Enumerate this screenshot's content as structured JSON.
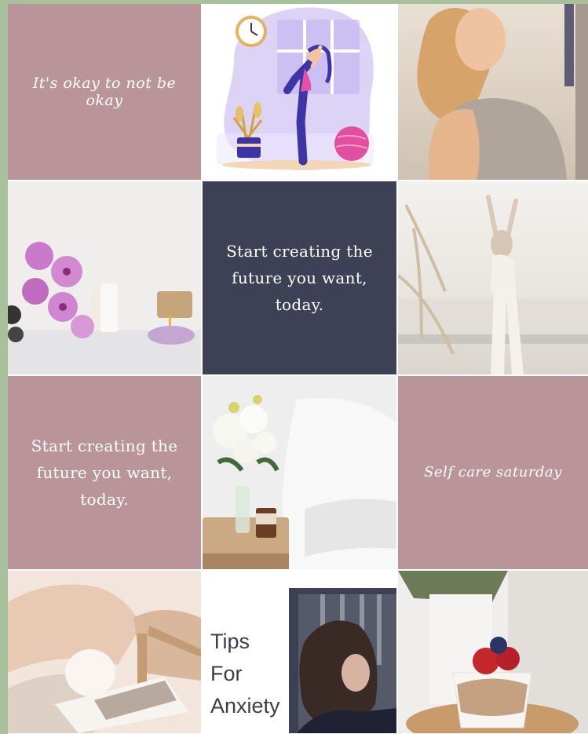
{
  "tiles": {
    "quote_script": "It's okay to not be okay",
    "quote_navy": "Start creating the future you want, today.",
    "quote_pink": "Start creating the future you want, today.",
    "self_care": "Self care saturday",
    "tips_line1": "Tips",
    "tips_line2": "For",
    "tips_line3": "Anxiety"
  },
  "colors": {
    "page_border": "#a7c19d",
    "dusty_pink": "#b99499",
    "navy": "#3e4055",
    "white": "#ffffff"
  },
  "icons": {
    "clock": "clock-icon",
    "yoga_figure": "yoga-figure-illustration",
    "ball": "exercise-ball-icon",
    "plant": "potted-plant-icon"
  }
}
